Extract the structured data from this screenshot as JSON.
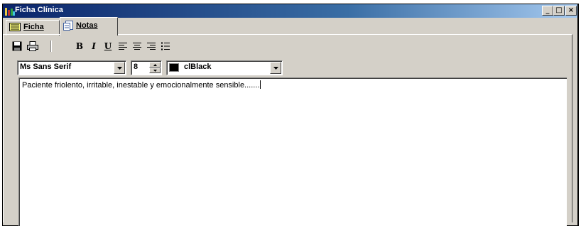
{
  "window": {
    "title": "Ficha Clínica",
    "titlebar_gradient": [
      "#0a246a",
      "#a6caf0"
    ],
    "face_color": "#d4d0c8",
    "caption_buttons": {
      "minimize": "_",
      "maximize": "□",
      "close": "×"
    }
  },
  "tabs": [
    {
      "label": "Ficha",
      "icon": "card-file-icon",
      "active": false
    },
    {
      "label": "Notas",
      "icon": "notes-page-icon",
      "active": true
    }
  ],
  "toolbar": {
    "items": [
      {
        "name": "save-icon"
      },
      {
        "name": "print-icon"
      },
      {
        "name": "bold",
        "glyph": "B"
      },
      {
        "name": "italic",
        "glyph": "I"
      },
      {
        "name": "underline",
        "glyph": "U"
      },
      {
        "name": "align-left-icon"
      },
      {
        "name": "align-center-icon"
      },
      {
        "name": "align-right-icon"
      },
      {
        "name": "bullet-list-icon"
      }
    ]
  },
  "format": {
    "font_name": "Ms Sans Serif",
    "font_size": "8",
    "color_name": "clBlack",
    "color_value": "#000000"
  },
  "editor": {
    "content": "Paciente friolento, irritable, inestable y emocionalmente sensible......."
  }
}
